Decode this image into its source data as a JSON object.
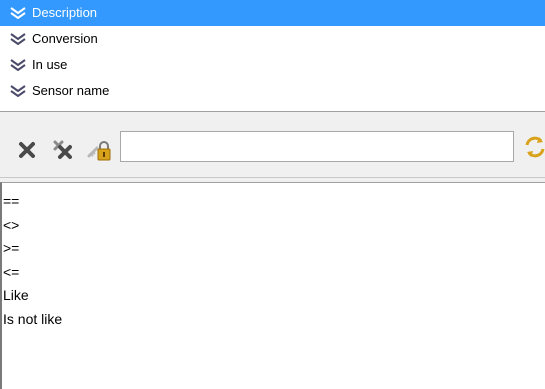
{
  "field_list": {
    "items": [
      {
        "label": "Description",
        "selected": true,
        "icon": "double-chevron-down-icon"
      },
      {
        "label": "Conversion",
        "selected": false,
        "icon": "double-chevron-down-icon"
      },
      {
        "label": "In use",
        "selected": false,
        "icon": "double-chevron-down-icon"
      },
      {
        "label": "Sensor name",
        "selected": false,
        "icon": "double-chevron-down-icon"
      }
    ]
  },
  "toolbar": {
    "buttons": [
      {
        "name": "delete-icon"
      },
      {
        "name": "delete-all-icon"
      },
      {
        "name": "lock-key-icon"
      },
      {
        "name": "refresh-icon"
      }
    ],
    "filter_value": ""
  },
  "operators": {
    "items": [
      "==",
      "<>",
      ">=",
      "<=",
      "Like",
      "Is not like"
    ]
  },
  "colors": {
    "selection": "#3399ff",
    "icon_gray": "#4a4a4a",
    "icon_gold": "#d9a21b"
  }
}
